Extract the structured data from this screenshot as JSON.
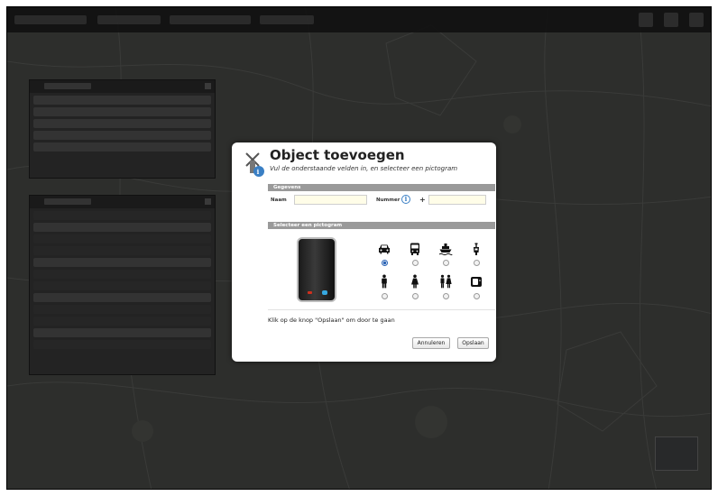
{
  "modal": {
    "title": "Object toevoegen",
    "subtitle": "Vul de onderstaande velden in, en selecteer een pictogram",
    "gegevens_section": {
      "header": "Gegevens",
      "naam_label": "Naam",
      "naam_value": "",
      "nummer_label": "Nummer",
      "plus": "+",
      "nummer_value": ""
    },
    "pictogram_section": {
      "header": "Selecteer een pictogram",
      "pictograms": [
        {
          "icon": "car-icon",
          "selected": true
        },
        {
          "icon": "bus-icon",
          "selected": false
        },
        {
          "icon": "boat-icon",
          "selected": false
        },
        {
          "icon": "scooter-icon",
          "selected": false
        },
        {
          "icon": "man-icon",
          "selected": false
        },
        {
          "icon": "woman-icon",
          "selected": false
        },
        {
          "icon": "couple-icon",
          "selected": false
        },
        {
          "icon": "device-icon",
          "selected": false
        }
      ]
    },
    "instruction": "Klik op de knop \"Opslaan\" om door te gaan",
    "buttons": {
      "cancel": "Annuleren",
      "save": "Opslaan"
    }
  },
  "colors": {
    "section_bar": "#9a9a9a",
    "input_bg": "#fffde8",
    "overlay": "#2d2e2c",
    "radio_checked": "#2a63b5"
  }
}
